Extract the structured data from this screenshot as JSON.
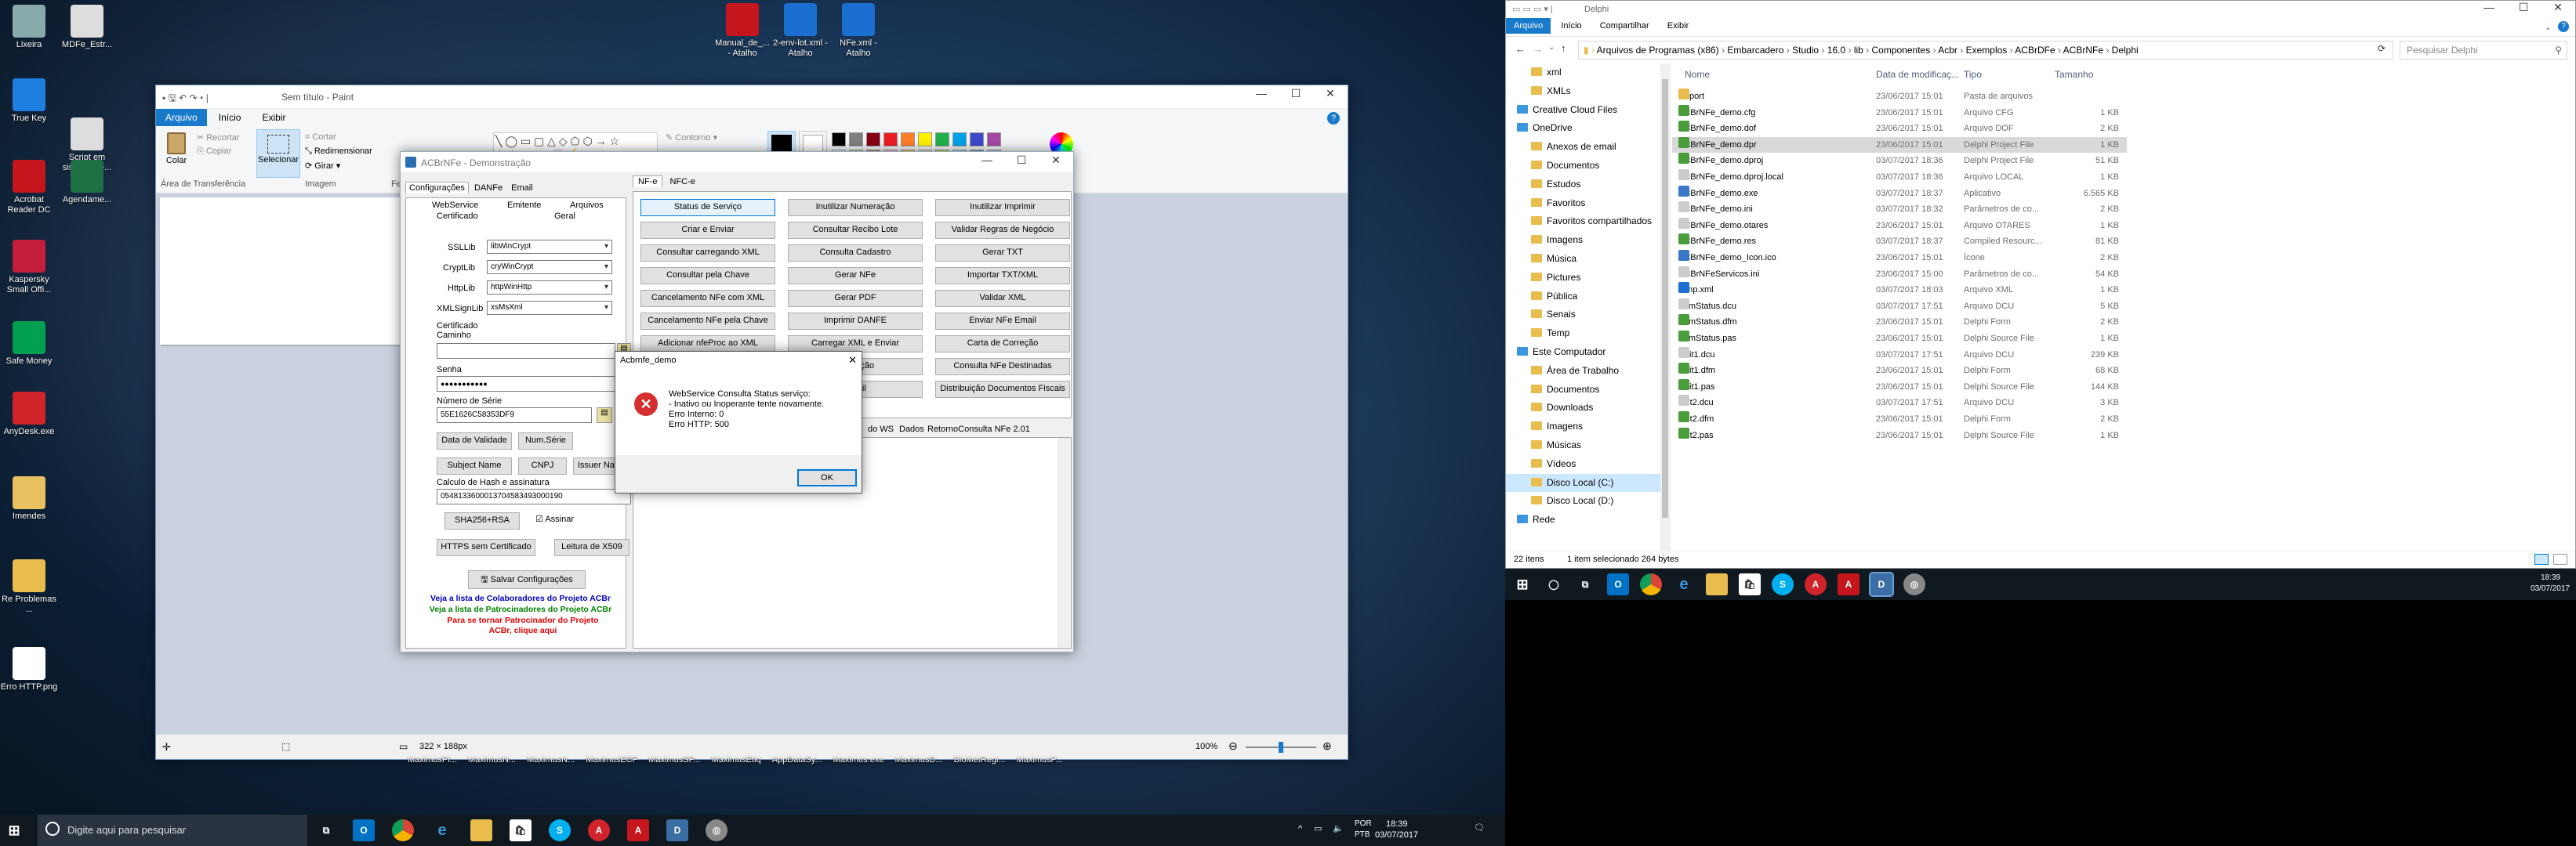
{
  "desktop": {
    "icons": [
      {
        "label": "Lixeira",
        "color": "#8aa"
      },
      {
        "label": "MDFe_Estr...",
        "color": "#ddd"
      },
      {
        "label": "True Key",
        "color": "#1f7fe0"
      },
      {
        "label": "Script em sistema de...",
        "color": "#ddd"
      },
      {
        "label": "Acrobat Reader DC",
        "color": "#c4161c"
      },
      {
        "label": "Agendame...",
        "color": "#1e7145"
      },
      {
        "label": "Kaspersky Small Offi...",
        "color": "#c41e3a"
      },
      {
        "label": "Safe Money",
        "color": "#00a050"
      },
      {
        "label": "AnyDesk.exe",
        "color": "#d0232a"
      },
      {
        "label": "Imendes",
        "color": "#e8c060"
      },
      {
        "label": "Re Problemas ...",
        "color": "#e8bd4e"
      },
      {
        "label": "Erro HTTP.png",
        "color": "#fff"
      },
      {
        "label": "Manual_de_... - Atalho",
        "color": "#c4161c"
      },
      {
        "label": "2-env-lot.xml - Atalho",
        "color": "#1a6fd0"
      },
      {
        "label": "NFe.xml - Atalho",
        "color": "#1a6fd0"
      }
    ]
  },
  "paint": {
    "title": "Sem título - Paint",
    "tabs": [
      "Arquivo",
      "Início",
      "Exibir"
    ],
    "clipboard": {
      "paste": "Colar",
      "cut": "Recortar",
      "copy": "Copiar",
      "group": "Área de Transferência"
    },
    "image": {
      "select": "Selecionar",
      "crop": "Cortar",
      "resize": "Redimensionar",
      "rotate": "Girar",
      "group": "Imagem"
    },
    "tools_group": "Ferr",
    "outline": "Contorno",
    "fill": "",
    "status": {
      "size": "322 × 188px",
      "zoom": "100%"
    },
    "palette": [
      "#000000",
      "#7f7f7f",
      "#880015",
      "#ed1c24",
      "#ff7f27",
      "#fff200",
      "#22b14c",
      "#00a2e8",
      "#3f48cc",
      "#a349a4",
      "#ffffff",
      "#c3c3c3",
      "#b97a57",
      "#ffaec9",
      "#ffc90e",
      "#efe4b0",
      "#b5e61d",
      "#99d9ea",
      "#7092be",
      "#c8bfe7"
    ]
  },
  "acbr": {
    "title": "ACBrNFe - Demonstração",
    "tabs": [
      "Configurações",
      "DANFe",
      "Email"
    ],
    "subtabs": [
      "WebService",
      "Emitente",
      "Arquivos",
      "Certificado",
      "Geral"
    ],
    "ssllib": {
      "label": "SSLLib",
      "value": "libWinCrypt"
    },
    "cryptlib": {
      "label": "CryptLib",
      "value": "cryWinCrypt"
    },
    "httplib": {
      "label": "HttpLib",
      "value": "httpWinHttp"
    },
    "xmlsign": {
      "label": "XMLSignLib",
      "value": "xsMsXml"
    },
    "cert_label": "Certificado",
    "caminho": "Caminho",
    "senha": "Senha",
    "senha_value": "●●●●●●●●●●●",
    "serie_label": "Número de Série",
    "serie_value": "55E1626C58353DF9",
    "btn_validade": "Data de Validade",
    "btn_numserie": "Num.Série",
    "btn_subject": "Subject Name",
    "btn_cnpj": "CNPJ",
    "btn_issuer": "Issuer Name",
    "hash_label": "Calculo de Hash e assinatura",
    "hash_value": "0548133600013704583493000190",
    "btn_sha": "SHA256+RSA",
    "assinar": "Assinar",
    "btn_https": "HTTPS sem Certificado",
    "btn_x509": "Leitura de X509",
    "btn_salvar": "Salvar Configurações",
    "link1": "Veja a lista de Colaboradores do Projeto ACBr",
    "link2": "Veja a lista de Patrocinadores do Projeto ACBr",
    "link3": "Para se tornar Patrocinador do Projeto ACBr, clique aqui",
    "right_tabs": [
      "NF-e",
      "NFC-e"
    ],
    "buttons": [
      [
        "Status de Serviço",
        "Inutilizar Numeração",
        "Inutilizar Imprimir"
      ],
      [
        "Criar e Enviar",
        "Consultar Recibo Lote",
        "Validar Regras de Negócio"
      ],
      [
        "Consultar carregando XML",
        "Consulta Cadastro",
        "Gerar TXT"
      ],
      [
        "Consultar pela Chave",
        "Gerar NFe",
        "Importar TXT/XML"
      ],
      [
        "Cancelamento NFe com XML",
        "Gerar PDF",
        "Validar XML"
      ],
      [
        "Cancelamento NFe pela Chave",
        "Imprimir DANFE",
        "Enviar NFe Email"
      ],
      [
        "Adicionar nfeProc ao XML",
        "Carregar XML e Enviar",
        "Carta de Correção"
      ],
      [
        "",
        "Operação",
        "Consulta NFe Destinadas"
      ],
      [
        "",
        "Email",
        "Distribuição Documentos Fiscais"
      ]
    ],
    "bottom_tabs": [
      "Dados",
      "RetornoConsulta NFe 2.01"
    ],
    "bottom_tab_ws": "do WS"
  },
  "dialog": {
    "title": "Acbrnfe_demo",
    "message": [
      "WebService Consulta Status serviço:",
      "- Inativo ou Inoperante tente novamente.",
      "Erro Interno: 0",
      "Erro HTTP: 500"
    ],
    "ok": "OK"
  },
  "taskbar1": {
    "search_placeholder": "Digite aqui para pesquisar",
    "lang": "POR",
    "lang2": "PTB",
    "time": "18:39",
    "date": "03/07/2017",
    "floating": [
      "MaximusPl...",
      "MaximusN...",
      "MaximusN...",
      "MaximusECF",
      "MaximusSP...",
      "MaximusEtiq",
      "AppDataSy...",
      "Maximus.exe",
      "MaximusD...",
      "BioMetRegi...",
      "MaximusP..."
    ]
  },
  "explorer": {
    "title": "Delphi",
    "tabs": [
      "Arquivo",
      "Início",
      "Compartilhar",
      "Exibir"
    ],
    "path": [
      "Arquivos de Programas (x86)",
      "Embarcadero",
      "Studio",
      "16.0",
      "lib",
      "Componentes",
      "Acbr",
      "Exemplos",
      "ACBrDFe",
      "ACBrNFe",
      "Delphi"
    ],
    "search_placeholder": "Pesquisar Delphi",
    "columns": [
      "Nome",
      "Data de modificaç...",
      "Tipo",
      "Tamanho"
    ],
    "nav": [
      {
        "label": "xml",
        "indent": 1
      },
      {
        "label": "XMLs",
        "indent": 1
      },
      {
        "label": "Creative Cloud Files",
        "indent": 0
      },
      {
        "label": "OneDrive",
        "indent": 0
      },
      {
        "label": "Anexos de email",
        "indent": 1
      },
      {
        "label": "Documentos",
        "indent": 1
      },
      {
        "label": "Estudos",
        "indent": 1
      },
      {
        "label": "Favoritos",
        "indent": 1
      },
      {
        "label": "Favoritos compartilhados",
        "indent": 1
      },
      {
        "label": "Imagens",
        "indent": 1
      },
      {
        "label": "Música",
        "indent": 1
      },
      {
        "label": "Pictures",
        "indent": 1
      },
      {
        "label": "Pública",
        "indent": 1
      },
      {
        "label": "Senais",
        "indent": 1
      },
      {
        "label": "Temp",
        "indent": 1
      },
      {
        "label": "Este Computador",
        "indent": 0
      },
      {
        "label": "Área de Trabalho",
        "indent": 1
      },
      {
        "label": "Documentos",
        "indent": 1
      },
      {
        "label": "Downloads",
        "indent": 1
      },
      {
        "label": "Imagens",
        "indent": 1
      },
      {
        "label": "Músicas",
        "indent": 1
      },
      {
        "label": "Vídeos",
        "indent": 1
      },
      {
        "label": "Disco Local (C:)",
        "indent": 1
      },
      {
        "label": "Disco Local (D:)",
        "indent": 1
      },
      {
        "label": "Rede",
        "indent": 0
      }
    ],
    "files": [
      {
        "name": "Report",
        "date": "23/06/2017 15:01",
        "type": "Pasta de arquivos",
        "size": "",
        "color": "#e8bd4e"
      },
      {
        "name": "ACBrNFe_demo.cfg",
        "date": "23/06/2017 15:01",
        "type": "Arquivo CFG",
        "size": "1 KB",
        "color": "#4a9e3a"
      },
      {
        "name": "ACBrNFe_demo.dof",
        "date": "23/06/2017 15:01",
        "type": "Arquivo DOF",
        "size": "2 KB",
        "color": "#4a9e3a"
      },
      {
        "name": "ACBrNFe_demo.dpr",
        "date": "23/06/2017 15:01",
        "type": "Delphi Project File",
        "size": "1 KB",
        "color": "#4a9e3a"
      },
      {
        "name": "ACBrNFe_demo.dproj",
        "date": "03/07/2017 18:36",
        "type": "Delphi Project File",
        "size": "51 KB",
        "color": "#4a9e3a"
      },
      {
        "name": "ACBrNFe_demo.dproj.local",
        "date": "03/07/2017 18:36",
        "type": "Arquivo LOCAL",
        "size": "1 KB",
        "color": "#ccc"
      },
      {
        "name": "ACBrNFe_demo.exe",
        "date": "03/07/2017 18:37",
        "type": "Aplicativo",
        "size": "6.565 KB",
        "color": "#3a78c8"
      },
      {
        "name": "ACBrNFe_demo.ini",
        "date": "03/07/2017 18:32",
        "type": "Parâmetros de co...",
        "size": "2 KB",
        "color": "#ccc"
      },
      {
        "name": "ACBrNFe_demo.otares",
        "date": "23/06/2017 15:01",
        "type": "Arquivo OTARES",
        "size": "1 KB",
        "color": "#ccc"
      },
      {
        "name": "ACBrNFe_demo.res",
        "date": "03/07/2017 18:37",
        "type": "Compiled Resourc...",
        "size": "81 KB",
        "color": "#4a9e3a"
      },
      {
        "name": "ACBrNFe_demo_Icon.ico",
        "date": "23/06/2017 15:01",
        "type": "Ícone",
        "size": "2 KB",
        "color": "#3a78c8"
      },
      {
        "name": "ACBrNFeServicos.ini",
        "date": "23/06/2017 15:00",
        "type": "Parâmetros de co...",
        "size": "54 KB",
        "color": "#ccc"
      },
      {
        "name": "temp.xml",
        "date": "03/07/2017 18:03",
        "type": "Arquivo XML",
        "size": "1 KB",
        "color": "#1a6fd0"
      },
      {
        "name": "ufrmStatus.dcu",
        "date": "03/07/2017 17:51",
        "type": "Arquivo DCU",
        "size": "5 KB",
        "color": "#ccc"
      },
      {
        "name": "ufrmStatus.dfm",
        "date": "23/06/2017 15:01",
        "type": "Delphi Form",
        "size": "2 KB",
        "color": "#4a9e3a"
      },
      {
        "name": "ufrmStatus.pas",
        "date": "23/06/2017 15:01",
        "type": "Delphi Source File",
        "size": "1 KB",
        "color": "#4a9e3a"
      },
      {
        "name": "Unit1.dcu",
        "date": "03/07/2017 17:51",
        "type": "Arquivo DCU",
        "size": "239 KB",
        "color": "#ccc"
      },
      {
        "name": "Unit1.dfm",
        "date": "23/06/2017 15:01",
        "type": "Delphi Form",
        "size": "68 KB",
        "color": "#4a9e3a"
      },
      {
        "name": "Unit1.pas",
        "date": "23/06/2017 15:01",
        "type": "Delphi Source File",
        "size": "144 KB",
        "color": "#4a9e3a"
      },
      {
        "name": "unit2.dcu",
        "date": "03/07/2017 17:51",
        "type": "Arquivo DCU",
        "size": "3 KB",
        "color": "#ccc"
      },
      {
        "name": "unit2.dfm",
        "date": "23/06/2017 15:01",
        "type": "Delphi Form",
        "size": "2 KB",
        "color": "#4a9e3a"
      },
      {
        "name": "unit2.pas",
        "date": "23/06/2017 15:01",
        "type": "Delphi Source File",
        "size": "1 KB",
        "color": "#4a9e3a"
      }
    ],
    "status": {
      "count": "22 itens",
      "selected": "1 item selecionado  264 bytes"
    }
  },
  "taskbar2": {
    "time": "18:39",
    "date": "03/07/2017"
  }
}
